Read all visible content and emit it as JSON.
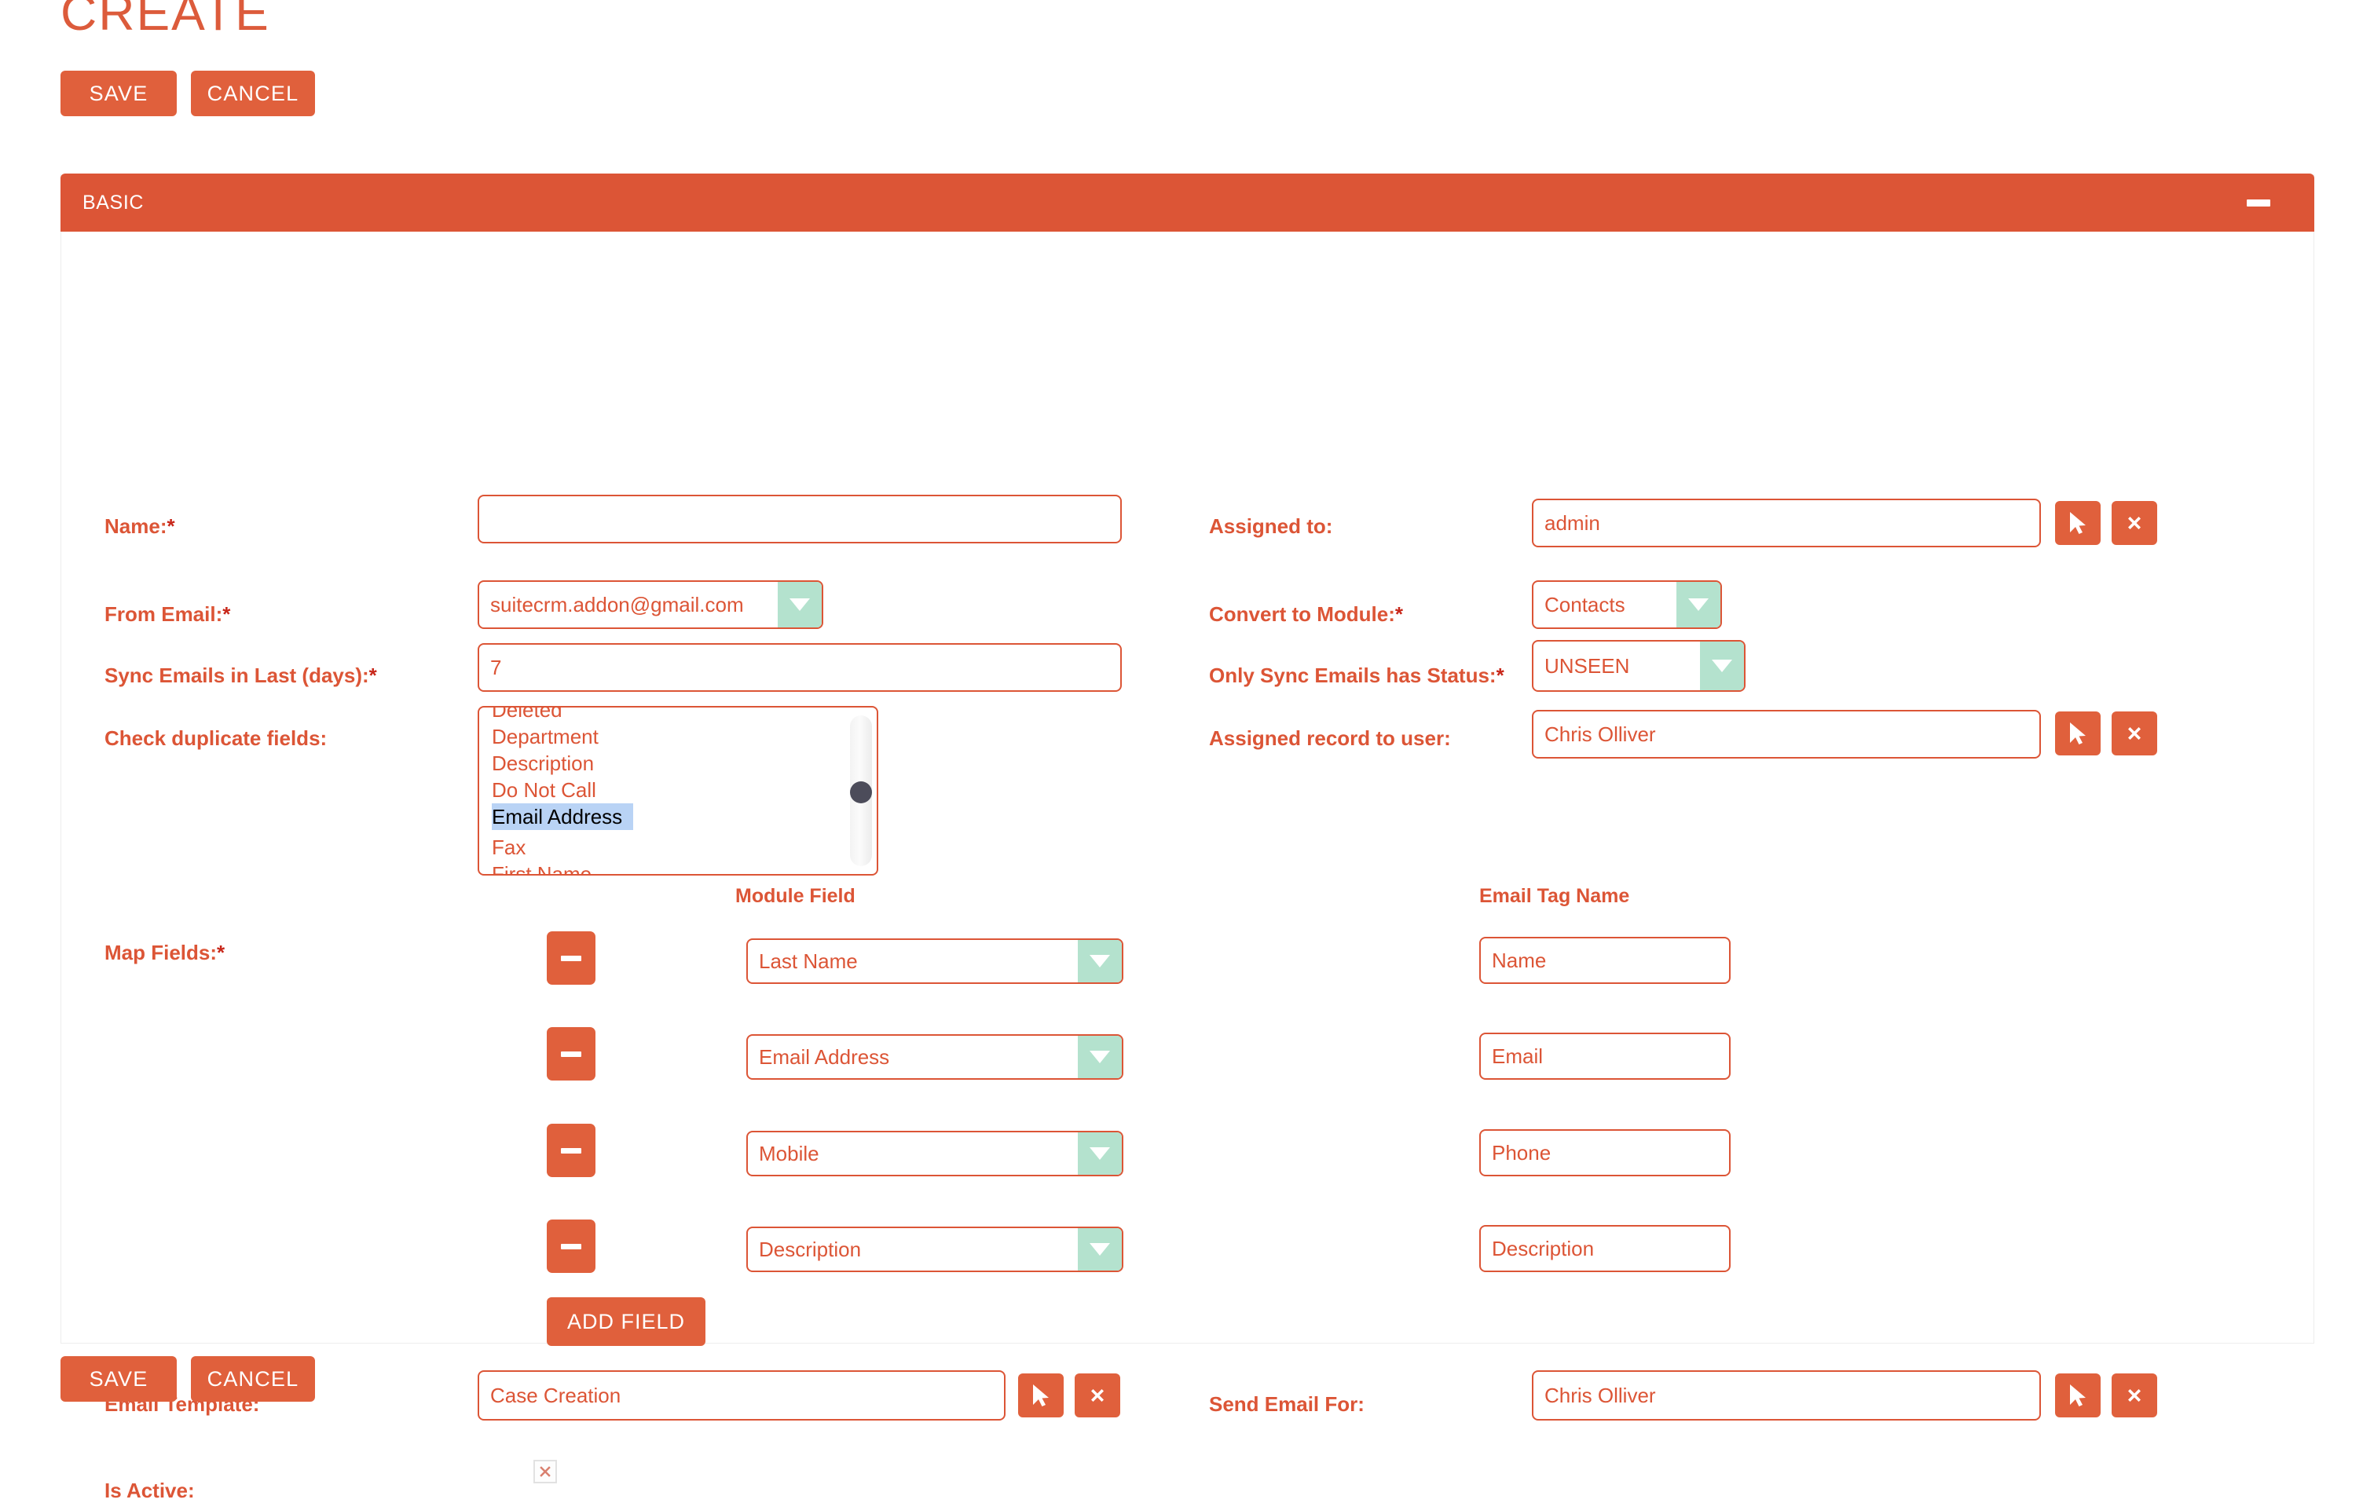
{
  "header": {
    "title": "CREATE"
  },
  "toolbar": {
    "save_label": "SAVE",
    "cancel_label": "CANCEL"
  },
  "panel": {
    "title": "BASIC",
    "collapse_icon": "minus-icon"
  },
  "colors": {
    "accent": "#dc5536",
    "button": "#e0603c",
    "dropdown_arrow_bg": "#b4e2ce",
    "listbox_selection": "#b9d3f5",
    "scroll_thumb": "#4c4c5a"
  },
  "fields": {
    "name": {
      "label": "Name:",
      "required": "*",
      "value": "",
      "placeholder": ""
    },
    "from_email": {
      "label": "From Email:",
      "required": "*",
      "value": "suitecrm.addon@gmail.com"
    },
    "sync_days": {
      "label": "Sync Emails in Last (days):",
      "required": "*",
      "value": "7"
    },
    "check_duplicate_fields": {
      "label": "Check duplicate fields:",
      "options": [
        "Deleted",
        "Department",
        "Description",
        "Do Not Call",
        "Email Address",
        "Fax",
        "First Name"
      ],
      "selected": "Email Address"
    },
    "assigned_to": {
      "label": "Assigned to:",
      "value": "admin"
    },
    "convert_to_module": {
      "label": "Convert to Module:",
      "required": "*",
      "value": "Contacts"
    },
    "only_sync_status": {
      "label": "Only Sync Emails has Status:",
      "required": "*",
      "value": "UNSEEN"
    },
    "assigned_record_to_user": {
      "label": "Assigned record to user:",
      "value": "Chris Olliver"
    },
    "map_fields": {
      "label": "Map Fields:",
      "required": "*",
      "module_field_header": "Module Field",
      "email_tag_header": "Email Tag Name",
      "add_field_label": "ADD FIELD",
      "remove_icon": "minus-icon",
      "rows": [
        {
          "module_field": "Last Name",
          "email_tag": "Name"
        },
        {
          "module_field": "Email Address",
          "email_tag": "Email"
        },
        {
          "module_field": "Mobile",
          "email_tag": "Phone"
        },
        {
          "module_field": "Description",
          "email_tag": "Description"
        }
      ]
    },
    "email_template": {
      "label": "Email Template:",
      "value": "Case Creation"
    },
    "send_email_for": {
      "label": "Send Email For:",
      "value": "Chris Olliver"
    },
    "is_active": {
      "label": "Is Active:",
      "checked": "true",
      "icon": "x-mark-icon"
    }
  },
  "icons": {
    "select_button": "arrow-cursor-icon",
    "clear_button": "x-icon"
  }
}
